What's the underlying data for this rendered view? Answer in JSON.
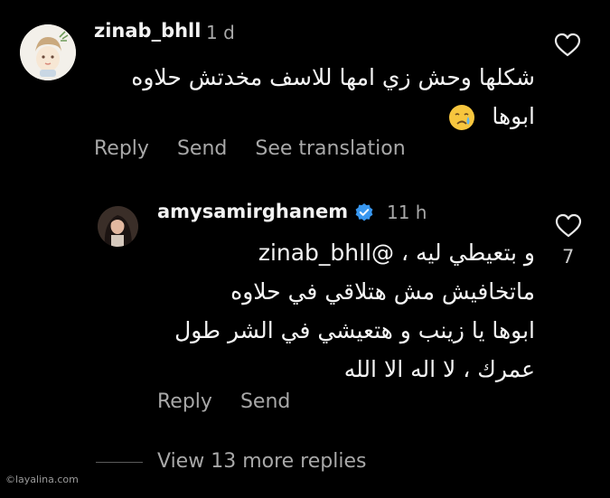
{
  "comments": [
    {
      "username": "zinab_bhll",
      "time": "1 d",
      "text_lines": [
        "شكلها وحش زي امها للاسف مخدتش حلاوه",
        "ابوها"
      ],
      "actions": {
        "reply": "Reply",
        "send": "Send",
        "translate": "See translation"
      }
    },
    {
      "username": "amysamirghanem",
      "time": "11 h",
      "likes": "7",
      "text_lines": [
        "و بتعيطي ليه ، @zinab_bhll",
        "ماتخافيش مش هتلاقي في حلاوه",
        "ابوها يا زينب و هتعيشي في الشر طول",
        "عمرك ، لا اله الا الله"
      ],
      "actions": {
        "reply": "Reply",
        "send": "Send"
      }
    }
  ],
  "view_more": "View 13 more replies",
  "watermark": "©layalina.com",
  "icons": {
    "heart": "heart-outline-icon",
    "verified": "verified-badge-icon",
    "emoji": "crying-face-emoji"
  },
  "colors": {
    "background": "#000000",
    "primary_text": "#f4f4f4",
    "secondary_text": "#a8a8a8",
    "verified": "#3897f0"
  }
}
